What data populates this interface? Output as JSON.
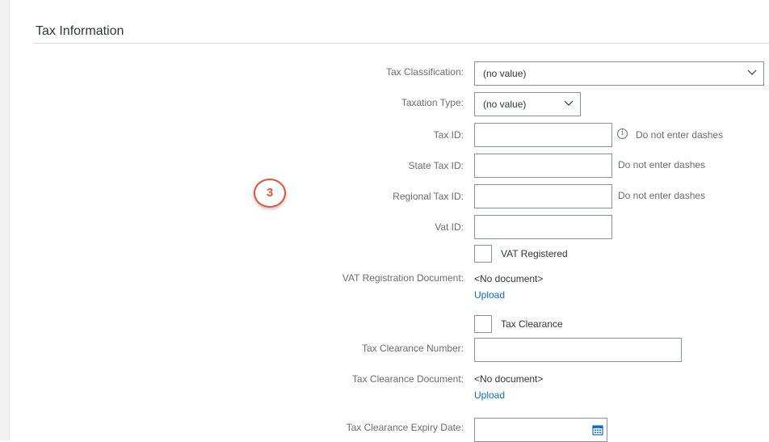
{
  "section": {
    "title": "Tax Information"
  },
  "step_badge": "3",
  "fields": {
    "tax_classification": {
      "label": "Tax Classification:",
      "value": "(no value)"
    },
    "taxation_type": {
      "label": "Taxation Type:",
      "value": "(no value)"
    },
    "tax_id": {
      "label": "Tax ID:",
      "value": "",
      "hint": "Do not enter dashes"
    },
    "state_tax_id": {
      "label": "State Tax ID:",
      "value": "",
      "hint": "Do not enter dashes"
    },
    "regional_tax_id": {
      "label": "Regional Tax ID:",
      "value": "",
      "hint": "Do not enter dashes"
    },
    "vat_id": {
      "label": "Vat ID:",
      "value": ""
    },
    "vat_registered": {
      "label": "VAT Registered",
      "checked": false
    },
    "vat_registration_document": {
      "label": "VAT Registration Document:",
      "value": "<No document>",
      "link": "Upload"
    },
    "tax_clearance": {
      "label": "Tax Clearance",
      "checked": false
    },
    "tax_clearance_number": {
      "label": "Tax Clearance Number:",
      "value": ""
    },
    "tax_clearance_document": {
      "label": "Tax Clearance Document:",
      "value": "<No document>",
      "link": "Upload"
    },
    "tax_clearance_expiry_date": {
      "label": "Tax Clearance Expiry Date:",
      "value": ""
    }
  },
  "colors": {
    "accent": "#0a6ed1",
    "badge": "#e2553a",
    "border": "#89919a",
    "label": "#6a6d70"
  }
}
